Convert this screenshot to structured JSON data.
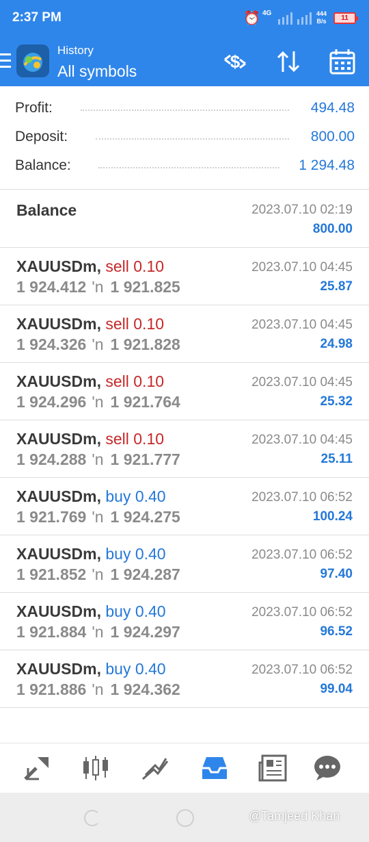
{
  "status_bar": {
    "time": "2:37 PM",
    "network": "4G",
    "speed_value": "444",
    "speed_unit": "B/s",
    "battery": "11"
  },
  "header": {
    "subtitle": "History",
    "title": "All symbols",
    "icons": [
      "currency-exchange-icon",
      "sort-arrows-icon",
      "calendar-icon"
    ]
  },
  "summary": {
    "profit_label": "Profit:",
    "profit_value": "494.48",
    "deposit_label": "Deposit:",
    "deposit_value": "800.00",
    "balance_label": "Balance:",
    "balance_value": "1 294.48"
  },
  "balance_entry": {
    "label": "Balance",
    "date": "2023.07.10 02:19",
    "amount": "800.00"
  },
  "deals": [
    {
      "symbol": "XAUUSDm,",
      "side": "sell 0.10",
      "open": "1 924.412",
      "arrow": "'n",
      "close": "1 921.825",
      "date": "2023.07.10 04:45",
      "profit": "25.87"
    },
    {
      "symbol": "XAUUSDm,",
      "side": "sell 0.10",
      "open": "1 924.326",
      "arrow": "'n",
      "close": "1 921.828",
      "date": "2023.07.10 04:45",
      "profit": "24.98"
    },
    {
      "symbol": "XAUUSDm,",
      "side": "sell 0.10",
      "open": "1 924.296",
      "arrow": "'n",
      "close": "1 921.764",
      "date": "2023.07.10 04:45",
      "profit": "25.32"
    },
    {
      "symbol": "XAUUSDm,",
      "side": "sell 0.10",
      "open": "1 924.288",
      "arrow": "'n",
      "close": "1 921.777",
      "date": "2023.07.10 04:45",
      "profit": "25.11"
    },
    {
      "symbol": "XAUUSDm,",
      "side": "buy 0.40",
      "open": "1 921.769",
      "arrow": "'n",
      "close": "1 924.275",
      "date": "2023.07.10 06:52",
      "profit": "100.24"
    },
    {
      "symbol": "XAUUSDm,",
      "side": "buy 0.40",
      "open": "1 921.852",
      "arrow": "'n",
      "close": "1 924.287",
      "date": "2023.07.10 06:52",
      "profit": "97.40"
    },
    {
      "symbol": "XAUUSDm,",
      "side": "buy 0.40",
      "open": "1 921.884",
      "arrow": "'n",
      "close": "1 924.297",
      "date": "2023.07.10 06:52",
      "profit": "96.52"
    },
    {
      "symbol": "XAUUSDm,",
      "side": "buy 0.40",
      "open": "1 921.886",
      "arrow": "'n",
      "close": "1 924.362",
      "date": "2023.07.10 06:52",
      "profit": "99.04"
    }
  ],
  "bottom_nav": {
    "items": [
      "quotes-icon",
      "chart-icon",
      "trade-icon",
      "history-icon",
      "news-icon",
      "chat-icon"
    ],
    "active": "history-icon"
  },
  "colors": {
    "primary": "#2f86ea",
    "sell": "#c62828",
    "buy": "#2478d8",
    "muted": "#8a8a8a"
  },
  "watermark": "@Tamjeed Khan"
}
